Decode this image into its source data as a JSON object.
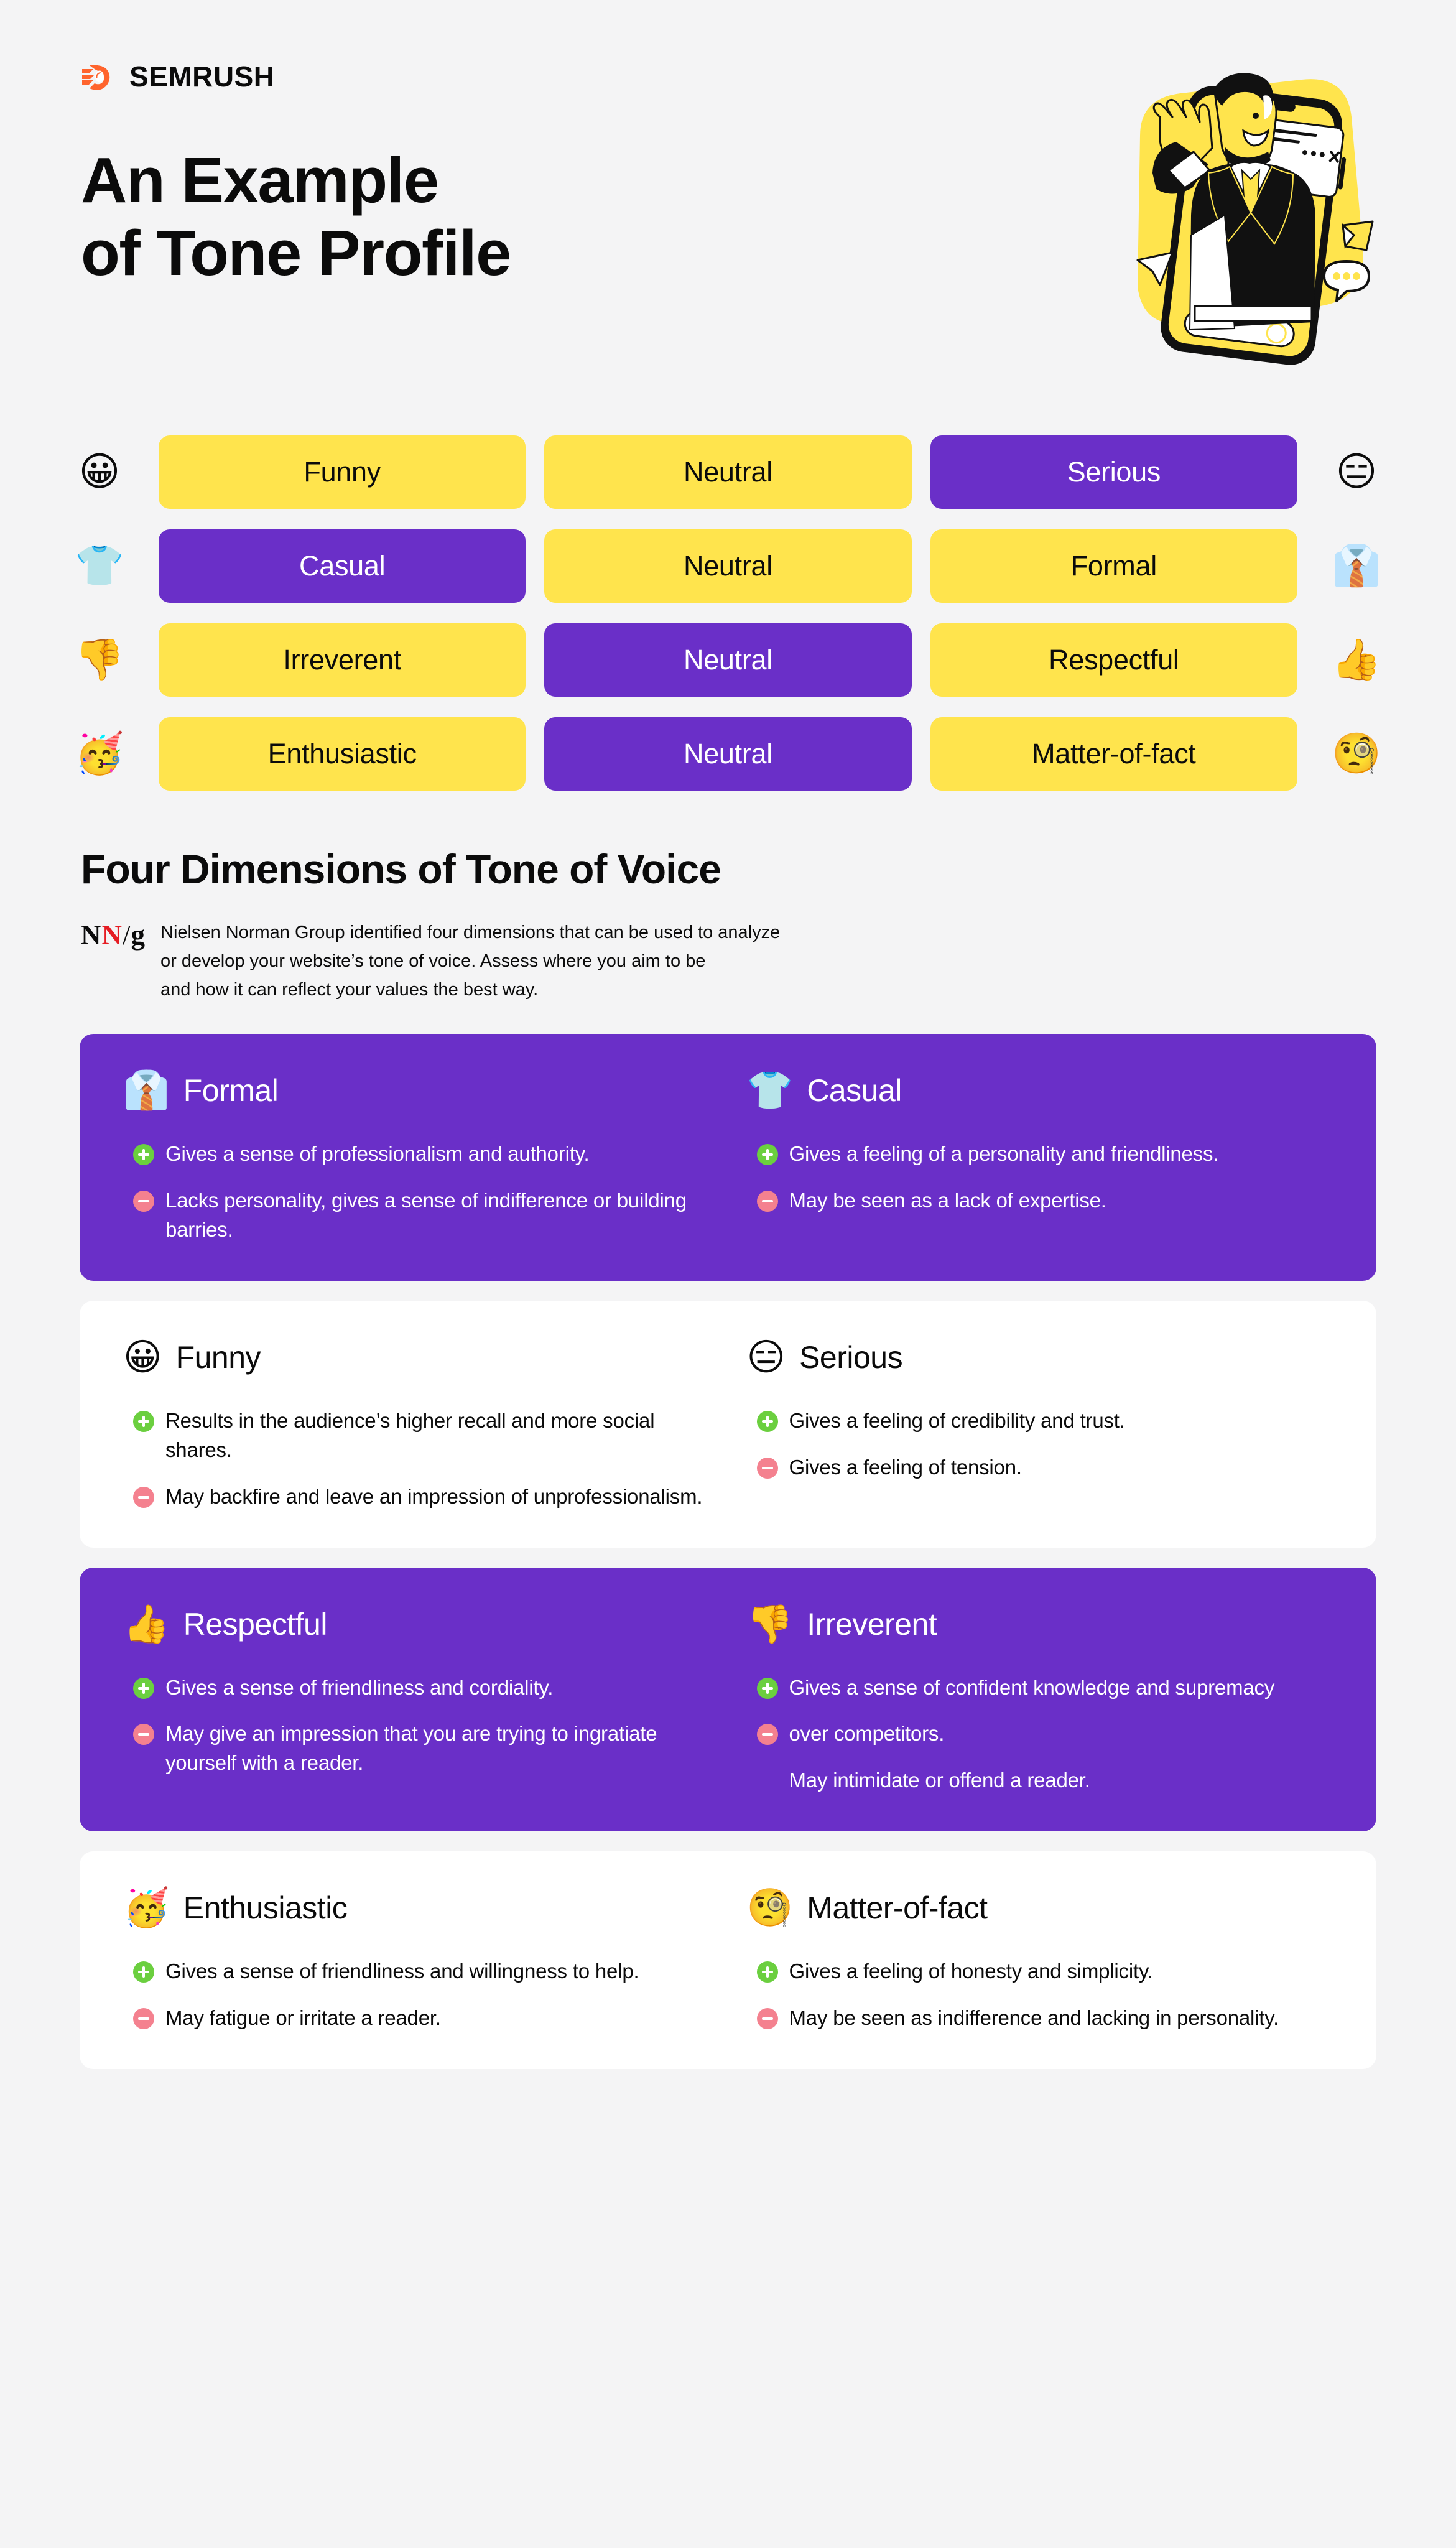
{
  "colors": {
    "background": "#f4f4f5",
    "yellow": "#ffe44d",
    "purple": "#6a2fc8",
    "white": "#ffffff",
    "brand_orange": "#ff642d",
    "plus_green": "#6bcf3f",
    "minus_red": "#f4818f",
    "nng_red": "#e51c23"
  },
  "brand": {
    "name": "SEMRUSH",
    "logo_icon": "semrush-logo-icon"
  },
  "title": {
    "line1": "An Example",
    "line2": "of Tone Profile"
  },
  "hero": {
    "icon": "man-waving-from-phone-illustration"
  },
  "matrix": {
    "rows": [
      {
        "left_emoji": "😀",
        "left_emoji_name": "grinning-face-emoji",
        "right_emoji": "😑",
        "right_emoji_name": "expressionless-face-emoji",
        "cells": [
          {
            "label": "Funny",
            "state": "unselected"
          },
          {
            "label": "Neutral",
            "state": "unselected"
          },
          {
            "label": "Serious",
            "state": "selected"
          }
        ]
      },
      {
        "left_emoji": "👕",
        "left_emoji_name": "t-shirt-emoji",
        "right_emoji": "👔",
        "right_emoji_name": "necktie-emoji",
        "cells": [
          {
            "label": "Casual",
            "state": "selected"
          },
          {
            "label": "Neutral",
            "state": "unselected"
          },
          {
            "label": "Formal",
            "state": "unselected"
          }
        ]
      },
      {
        "left_emoji": "👎",
        "left_emoji_name": "thumbs-down-emoji",
        "right_emoji": "👍",
        "right_emoji_name": "thumbs-up-emoji",
        "cells": [
          {
            "label": "Irreverent",
            "state": "unselected"
          },
          {
            "label": "Neutral",
            "state": "selected"
          },
          {
            "label": "Respectful",
            "state": "unselected"
          }
        ]
      },
      {
        "left_emoji": "🥳",
        "left_emoji_name": "partying-face-emoji",
        "right_emoji": "🧐",
        "right_emoji_name": "monocle-face-emoji",
        "cells": [
          {
            "label": "Enthusiastic",
            "state": "unselected"
          },
          {
            "label": "Neutral",
            "state": "selected"
          },
          {
            "label": "Matter-of-fact",
            "state": "unselected"
          }
        ]
      }
    ]
  },
  "section": {
    "heading": "Four Dimensions of Tone of Voice",
    "nng_logo": {
      "n1": "N",
      "n2": "N",
      "slash": "/",
      "g": "g"
    },
    "paragraph_lines": [
      "Nielsen Norman Group identified four dimensions that can be used to analyze",
      "or develop your website’s tone of voice. Assess where you aim to be",
      "and how it can reflect your values the best way."
    ]
  },
  "cards": [
    {
      "theme": "purple",
      "left": {
        "emoji": "👔",
        "emoji_name": "necktie-emoji",
        "title": "Formal",
        "bullets": [
          {
            "type": "plus",
            "text": "Gives a sense of professionalism and authority."
          },
          {
            "type": "minus",
            "text": "Lacks personality, gives a sense of indifference or building barries."
          }
        ]
      },
      "right": {
        "emoji": "👕",
        "emoji_name": "t-shirt-emoji",
        "title": "Casual",
        "bullets": [
          {
            "type": "plus",
            "text": "Gives a feeling of a personality and friendliness."
          },
          {
            "type": "minus",
            "text": "May be seen as a lack of expertise."
          }
        ]
      }
    },
    {
      "theme": "white",
      "left": {
        "emoji": "😀",
        "emoji_name": "grinning-face-emoji",
        "title": "Funny",
        "bullets": [
          {
            "type": "plus",
            "text": "Results in the audience’s higher recall and more social shares."
          },
          {
            "type": "minus",
            "text": "May backfire and leave an impression of unprofessionalism."
          }
        ]
      },
      "right": {
        "emoji": "😑",
        "emoji_name": "expressionless-face-emoji",
        "title": "Serious",
        "bullets": [
          {
            "type": "plus",
            "text": "Gives a feeling of credibility and trust."
          },
          {
            "type": "minus",
            "text": "Gives a feeling of tension."
          }
        ]
      }
    },
    {
      "theme": "purple",
      "left": {
        "emoji": "👍",
        "emoji_name": "thumbs-up-emoji",
        "title": "Respectful",
        "bullets": [
          {
            "type": "plus",
            "text": "Gives a sense of friendliness and cordiality."
          },
          {
            "type": "minus",
            "text": "May give an impression that you are trying to ingratiate yourself with a reader."
          }
        ]
      },
      "right": {
        "emoji": "👎",
        "emoji_name": "thumbs-down-emoji",
        "title": "Irreverent",
        "bullets": [
          {
            "type": "plus",
            "text": "Gives a sense of confident knowledge and supremacy"
          },
          {
            "type": "minus",
            "text": "over competitors."
          },
          {
            "type": "none",
            "text": "May intimidate or offend a reader."
          }
        ]
      }
    },
    {
      "theme": "white",
      "left": {
        "emoji": "🥳",
        "emoji_name": "partying-face-emoji",
        "title": "Enthusiastic",
        "bullets": [
          {
            "type": "plus",
            "text": "Gives a sense of friendliness and willingness to help."
          },
          {
            "type": "minus",
            "text": "May fatigue or irritate a reader."
          }
        ]
      },
      "right": {
        "emoji": "🧐",
        "emoji_name": "monocle-face-emoji",
        "title": "Matter-of-fact",
        "bullets": [
          {
            "type": "plus",
            "text": "Gives a feeling of honesty and simplicity."
          },
          {
            "type": "minus",
            "text": "May be seen as indifference and lacking in personality."
          }
        ]
      }
    }
  ]
}
